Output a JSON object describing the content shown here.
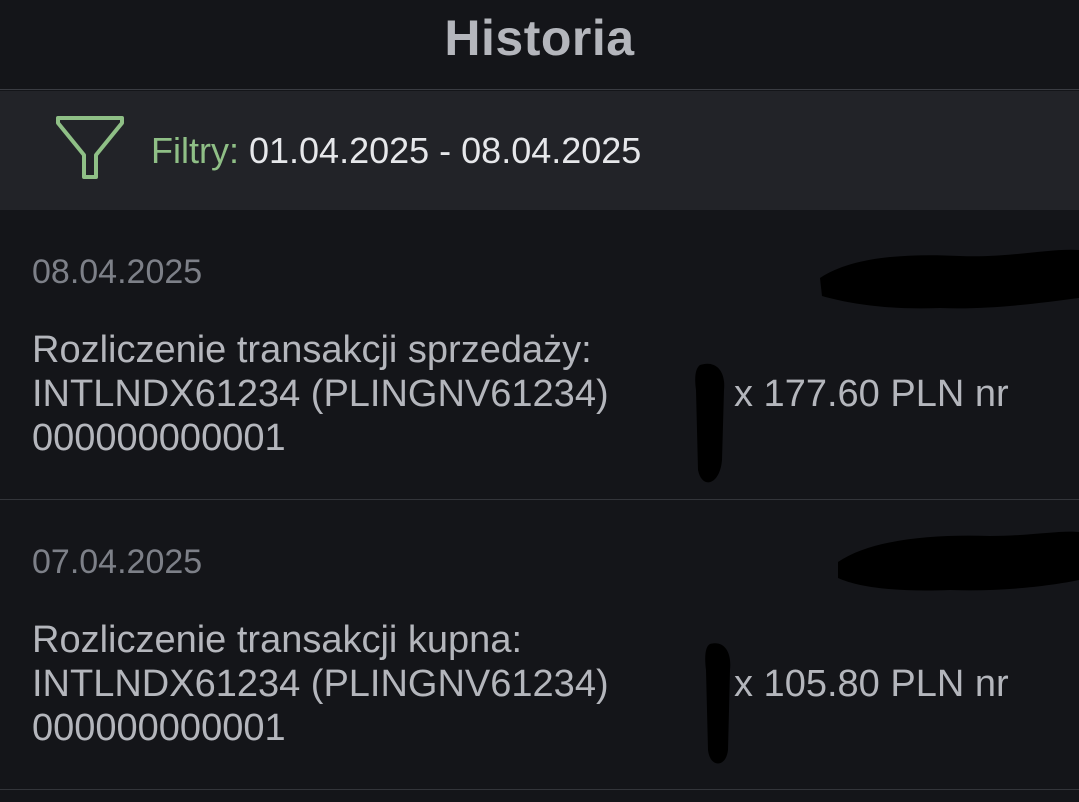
{
  "header": {
    "title": "Historia"
  },
  "filter": {
    "icon": "filter-funnel-icon",
    "label": "Filtry:",
    "value": " 01.04.2025 - 08.04.2025"
  },
  "colors": {
    "background": "#141519",
    "filter_bar": "#222328",
    "accent_green": "#8fbf86",
    "text_primary": "#b4b6bc",
    "text_secondary": "#7d8088"
  },
  "history": [
    {
      "date": "08.04.2025",
      "title": "Rozliczenie transakcji sprzedaży:",
      "instrument": "INTLNDX61234 (PLINGNV61234)",
      "amount": "x 177.60 PLN nr",
      "number": "000000000001"
    },
    {
      "date": "07.04.2025",
      "title": "Rozliczenie transakcji kupna:",
      "instrument": "INTLNDX61234 (PLINGNV61234)",
      "amount": "x 105.80 PLN nr",
      "number": "000000000001"
    }
  ]
}
